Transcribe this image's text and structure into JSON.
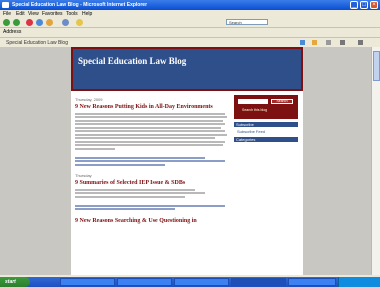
{
  "window": {
    "title": "Special Education Law Blog - Microsoft Internet Explorer"
  },
  "menu": [
    "File",
    "Edit",
    "View",
    "Favorites",
    "Tools",
    "Help"
  ],
  "toolbar": {
    "search_placeholder": "Search"
  },
  "address": {
    "label": "Address",
    "url": ""
  },
  "links": {
    "tab": "Special Education Law Blog"
  },
  "blog": {
    "title": "Special Education Law Blog",
    "description": "",
    "posts": [
      {
        "date": "Thursday, 2009",
        "title": "9 New Reasons Putting Kids in All-Day Environments"
      },
      {
        "date": "Thursday",
        "title": "9 Summaries of Selected IEP Issue & SDBs"
      },
      {
        "date": "",
        "title": "9 New Reasons Searching & Use Questioning in"
      }
    ]
  },
  "sidebar": {
    "search_button": "Search",
    "search_label": "Search this blog",
    "headings": [
      "Subscribe",
      "Categories"
    ],
    "links": [
      "Subscribe Feed",
      "",
      "",
      "",
      "",
      "",
      "",
      "",
      "",
      "",
      "",
      "",
      "",
      "",
      "",
      "",
      "",
      "",
      "",
      "",
      ""
    ]
  },
  "taskbar": {
    "start": "start",
    "clock": ""
  }
}
